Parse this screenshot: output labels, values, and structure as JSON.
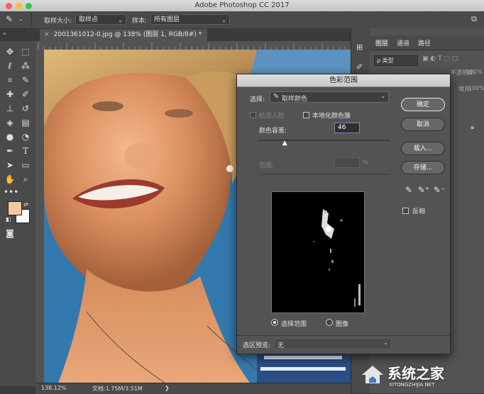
{
  "window": {
    "title": "Adobe Photoshop CC 2017"
  },
  "options_bar": {
    "sample_size_label": "取样大小:",
    "sample_size_value": "取样点",
    "sample_label": "样本:",
    "sample_value": "所有图层"
  },
  "document": {
    "tab_title": "20013610​12-0.jpg @ 138% (图层 1, RGB/8#) *",
    "zoom": "138.12%",
    "doc_size": "文档:1.75M/3.51M"
  },
  "panels": {
    "tabs": [
      "图层",
      "通道",
      "路径"
    ],
    "filter_label": "ρ 类型",
    "rows": [
      "不透明度:",
      "100%",
      "填充:",
      "100%"
    ]
  },
  "dialog": {
    "title": "色彩范围",
    "select_label": "选择:",
    "select_value": "取样颜色",
    "detect_faces": "检测人脸",
    "localized_clusters": "本地化颜色簇",
    "fuzziness_label": "颜色容差:",
    "fuzziness_value": "46",
    "range_label": "范围:",
    "range_unit": "%",
    "preview_selection": "选择范围",
    "preview_image": "图像",
    "selection_preview_label": "选区预览:",
    "selection_preview_value": "无",
    "buttons": {
      "ok": "确定",
      "cancel": "取消",
      "load": "载入...",
      "save": "存储..."
    },
    "invert_label": "反相",
    "fuzziness_slider": 0.2
  },
  "watermark": {
    "text": "系统之家",
    "url": "XITONGZHIJIA.NET"
  },
  "colors": {
    "foreground": "#f2c8a2",
    "background": "#ffffff",
    "canvas_bg": "#2f6fa0"
  }
}
